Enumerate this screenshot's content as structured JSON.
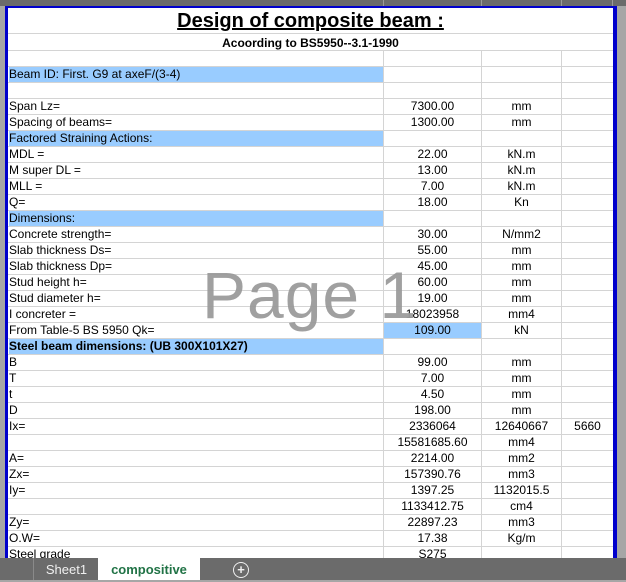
{
  "sheet": {
    "title": "Design of composite beam :",
    "subtitle": "Acoording to BS5950--3.1-1990",
    "watermark": "Page 1",
    "rows": [
      {
        "a": "",
        "b": "",
        "c": "",
        "d": ""
      },
      {
        "a": "Beam ID: First. G9 at axeF/(3-4)",
        "b": "",
        "c": "",
        "d": "",
        "highlight": true
      },
      {
        "a": "",
        "b": "",
        "c": "",
        "d": ""
      },
      {
        "a": "Span Lz=",
        "b": "7300.00",
        "c": "mm",
        "d": ""
      },
      {
        "a": "Spacing of beams=",
        "b": "1300.00",
        "c": "mm",
        "d": ""
      },
      {
        "a": "Factored Straining Actions:",
        "b": "",
        "c": "",
        "d": "",
        "highlight": true
      },
      {
        "a": "MDL =",
        "b": "22.00",
        "c": "kN.m",
        "d": ""
      },
      {
        "a": "M super DL =",
        "b": "13.00",
        "c": "kN.m",
        "d": ""
      },
      {
        "a": "MLL =",
        "b": "7.00",
        "c": "kN.m",
        "d": ""
      },
      {
        "a": "Q=",
        "b": "18.00",
        "c": "Kn",
        "d": ""
      },
      {
        "a": "Dimensions:",
        "b": "",
        "c": "",
        "d": "",
        "highlight": true
      },
      {
        "a": "Concrete strength=",
        "b": "30.00",
        "c": "N/mm2",
        "d": ""
      },
      {
        "a": "Slab thickness Ds=",
        "b": "55.00",
        "c": "mm",
        "d": ""
      },
      {
        "a": "Slab thickness Dp=",
        "b": "45.00",
        "c": "mm",
        "d": ""
      },
      {
        "a": "Stud height h=",
        "b": "60.00",
        "c": "mm",
        "d": ""
      },
      {
        "a": "Stud diameter h=",
        "b": "19.00",
        "c": "mm",
        "d": ""
      },
      {
        "a": "I concreter =",
        "b": "18023958",
        "c": "mm4",
        "d": ""
      },
      {
        "a": "From Table-5 BS 5950 Qk=",
        "b": "109.00",
        "c": "kN",
        "d": "",
        "highlight_b": true
      },
      {
        "a": "Steel beam dimensions: (UB 300X101X27)",
        "b": "",
        "c": "",
        "d": "",
        "highlight": true,
        "bold": true
      },
      {
        "a": "B",
        "b": "99.00",
        "c": "mm",
        "d": ""
      },
      {
        "a": "T",
        "b": "7.00",
        "c": "mm",
        "d": ""
      },
      {
        "a": "t",
        "b": "4.50",
        "c": "mm",
        "d": ""
      },
      {
        "a": "D",
        "b": "198.00",
        "c": "mm",
        "d": ""
      },
      {
        "a": "Ix=",
        "b": "2336064",
        "c": "12640667",
        "d": "5660"
      },
      {
        "a": "",
        "b": "15581685.60",
        "c": "mm4",
        "d": ""
      },
      {
        "a": "A=",
        "b": "2214.00",
        "c": "mm2",
        "d": ""
      },
      {
        "a": "Zx=",
        "b": "157390.76",
        "c": "mm3",
        "d": ""
      },
      {
        "a": "Iy=",
        "b": "1397.25",
        "c": "1132015.5",
        "d": ""
      },
      {
        "a": "",
        "b": "1133412.75",
        "c": "cm4",
        "d": ""
      },
      {
        "a": "Zy=",
        "b": "22897.23",
        "c": "mm3",
        "d": ""
      },
      {
        "a": "O.W=",
        "b": "17.38",
        "c": "Kg/m",
        "d": ""
      },
      {
        "a": "Steel grade",
        "b": "S275",
        "c": "",
        "d": ""
      }
    ]
  },
  "tabs": {
    "items": [
      {
        "label": "Sheet1",
        "active": false
      },
      {
        "label": "compositive",
        "active": true
      }
    ],
    "add_icon": "plus-circle-icon"
  },
  "colors": {
    "highlight": "#99ccff",
    "page_border": "#0000cc",
    "active_tab_text": "#217346"
  }
}
